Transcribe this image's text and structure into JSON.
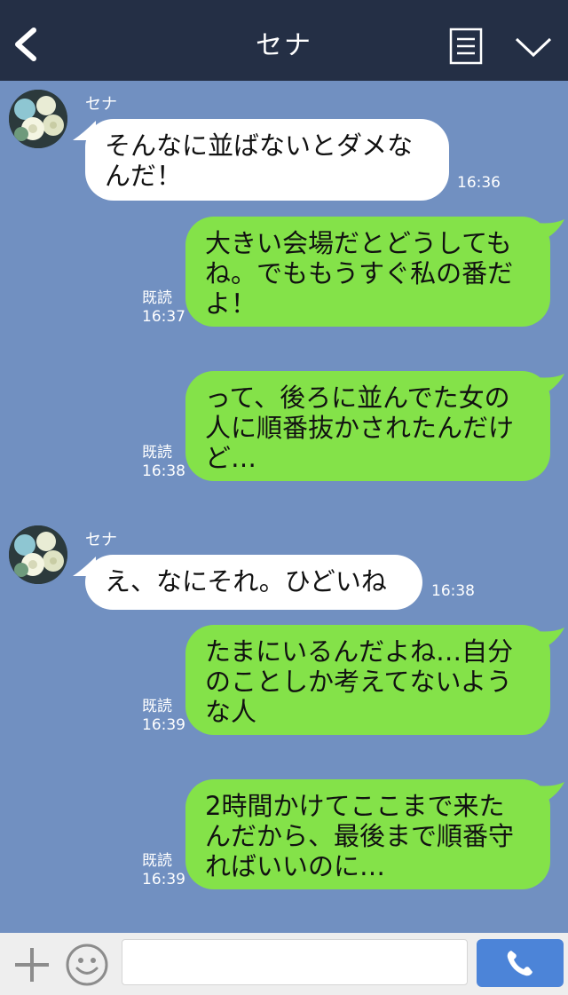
{
  "header": {
    "title": "セナ",
    "back_icon": "chevron-left-icon",
    "menu_icon": "note-icon",
    "collapse_icon": "chevron-down-icon"
  },
  "messages": [
    {
      "from": "セナ",
      "sender": "セナ",
      "lines": [
        "そんなに並ばないとダメな",
        "んだ！"
      ],
      "time": "16:36"
    },
    {
      "from": "me",
      "lines": [
        "大きい会場だとどうしても",
        "ね。でももうすぐ私の番だ",
        "よ！"
      ],
      "read": "既読",
      "time": "16:37"
    },
    {
      "from": "me",
      "lines": [
        "って、後ろに並んでた女の",
        "人に順番抜かされたんだけ",
        "ど…"
      ],
      "read": "既読",
      "time": "16:38"
    },
    {
      "from": "セナ",
      "sender": "セナ",
      "lines": [
        "え、なにそれ。ひどいね"
      ],
      "time": "16:38"
    },
    {
      "from": "me",
      "lines": [
        "たまにいるんだよね…自分",
        "のことしか考えてないよう",
        "な人"
      ],
      "read": "既読",
      "time": "16:39"
    },
    {
      "from": "me",
      "lines": [
        "2時間かけてここまで来た",
        "んだから、最後まで順番守",
        "ればいいのに…"
      ],
      "read": "既読",
      "time": "16:39"
    }
  ],
  "footer": {
    "input_value": "",
    "plus_icon": "plus-icon",
    "sticker_icon": "smile-icon",
    "call_icon": "phone-icon"
  },
  "colors": {
    "background": "#7190c1",
    "header": "#242f45",
    "bubble_out": "#84e249",
    "bubble_in": "#ffffff",
    "call_button": "#4c84d8"
  }
}
